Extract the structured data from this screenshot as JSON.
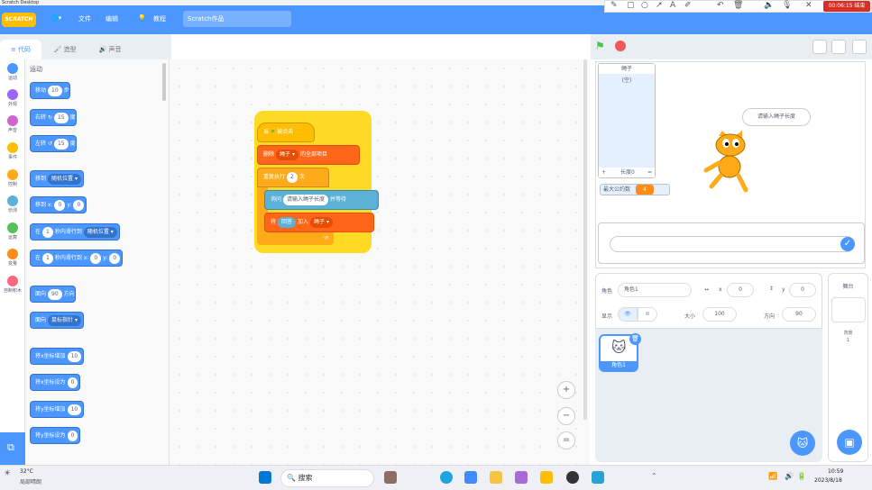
{
  "window": {
    "title": "Scratch Desktop"
  },
  "menubar": {
    "logo": "SCRATCH",
    "file": "文件",
    "edit": "编辑",
    "tutorials": "教程",
    "project_title": "Scratch作品"
  },
  "recorder": {
    "timer": "00:06:15 结束"
  },
  "tabs": {
    "code": "代码",
    "costumes": "造型",
    "sounds": "声音"
  },
  "categories": [
    {
      "label": "运动",
      "color": "#4c97ff"
    },
    {
      "label": "外观",
      "color": "#9966ff"
    },
    {
      "label": "声音",
      "color": "#cf63cf"
    },
    {
      "label": "事件",
      "color": "#ffbf00"
    },
    {
      "label": "控制",
      "color": "#ffab19"
    },
    {
      "label": "侦测",
      "color": "#5cb1d6"
    },
    {
      "label": "运算",
      "color": "#59c059"
    },
    {
      "label": "变量",
      "color": "#ff8c1a"
    },
    {
      "label": "自制积木",
      "color": "#ff6680"
    }
  ],
  "palette": {
    "heading": "运动",
    "move": {
      "a": "移动",
      "v": "10",
      "b": "步"
    },
    "turn_right": {
      "a": "右转",
      "v": "15",
      "b": "度"
    },
    "turn_left": {
      "a": "左转",
      "v": "15",
      "b": "度"
    },
    "goto": {
      "a": "移到",
      "dd": "随机位置"
    },
    "goto_xy": {
      "a": "移到 x:",
      "x": "0",
      "b": "y:",
      "y": "0"
    },
    "glide": {
      "a": "在",
      "v": "1",
      "b": "秒内滑行到",
      "dd": "随机位置"
    },
    "glide_xy": {
      "a": "在",
      "v": "1",
      "b": "秒内滑行到 x:",
      "x": "0",
      "c": "y:",
      "y": "0"
    },
    "point_dir": {
      "a": "面向",
      "v": "90",
      "b": "方向"
    },
    "point_towards": {
      "a": "面向",
      "dd": "鼠标指针"
    },
    "change_x": {
      "a": "将x坐标增加",
      "v": "10"
    },
    "set_x": {
      "a": "将x坐标设为",
      "v": "0"
    },
    "change_y": {
      "a": "将y坐标增加",
      "v": "10"
    },
    "set_y": {
      "a": "将y坐标设为",
      "v": "0"
    }
  },
  "script": {
    "hat": {
      "a": "当",
      "b": "被点击"
    },
    "delete_all": {
      "a": "删除",
      "dd": "绳子",
      "b": "的全部项目"
    },
    "repeat": {
      "a": "重复执行",
      "v": "2",
      "b": "次"
    },
    "ask": {
      "a": "询问",
      "v": "请输入绳子长度",
      "b": "并等待"
    },
    "add": {
      "a": "将",
      "r": "回答",
      "b": "加入",
      "dd": "绳子"
    },
    "arrow": "↺"
  },
  "zoom": {
    "in": "+",
    "out": "−",
    "reset": "="
  },
  "stage": {
    "list_title": "绳子",
    "list_empty": "(空)",
    "list_add": "+",
    "list_length": "长度0",
    "list_resize": "=",
    "var_label": "最大公约数",
    "var_value": "4",
    "speech": "请输入绳子长度"
  },
  "sprite_info": {
    "sprite_label": "角色",
    "sprite_name": "角色1",
    "x_label": "x",
    "x": "0",
    "y_label": "y",
    "y": "0",
    "show_label": "显示",
    "size_label": "大小",
    "size": "100",
    "dir_label": "方向",
    "dir": "90"
  },
  "sprite_list": [
    {
      "name": "角色1"
    }
  ],
  "stage_side": {
    "title": "舞台",
    "backdrops_label": "背景",
    "backdrops_count": "1"
  },
  "taskbar": {
    "temp": "32°C",
    "weather": "局部晴朗",
    "search": "搜索",
    "time": "10:59",
    "date": "2023/8/18"
  }
}
